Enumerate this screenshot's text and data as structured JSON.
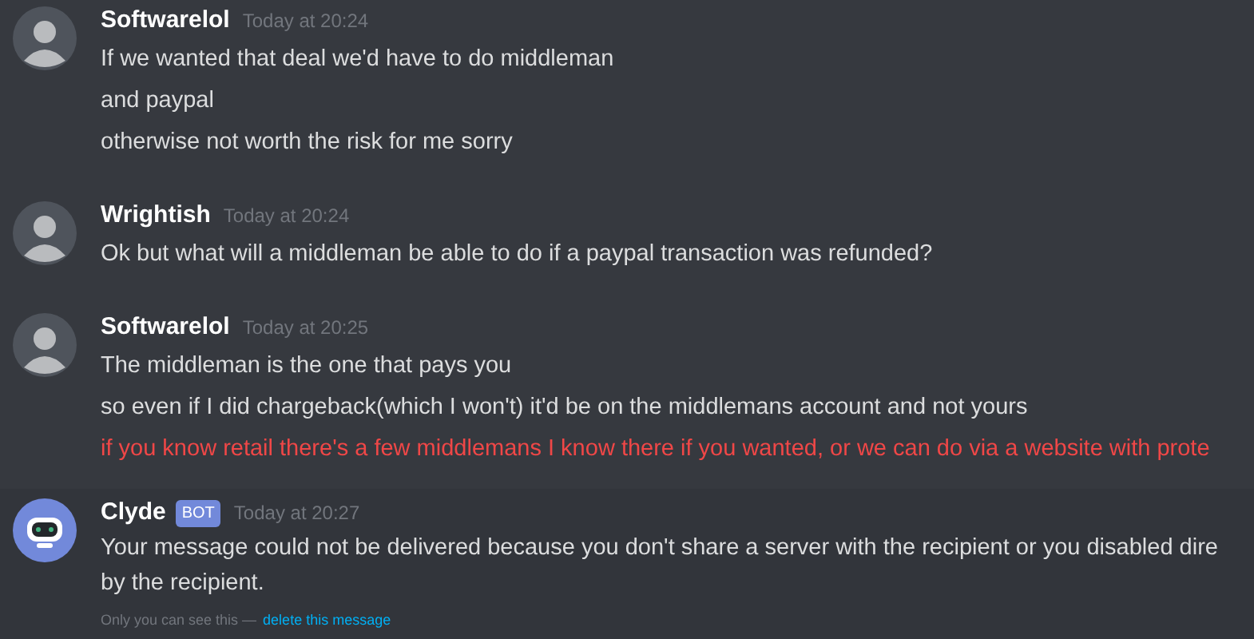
{
  "messages": [
    {
      "author": "Softwarelol",
      "time": "Today at 20:24",
      "ephemeral": false,
      "lines": [
        {
          "kind": "normal",
          "text": "If we wanted that deal we'd have to do middleman"
        },
        {
          "kind": "normal",
          "text": "and paypal"
        },
        {
          "kind": "normal",
          "text": "otherwise not worth the risk for me sorry"
        }
      ]
    },
    {
      "author": "Wrightish",
      "time": "Today at 20:24",
      "ephemeral": false,
      "lines": [
        {
          "kind": "normal",
          "text": "Ok but what will a middleman be able to do if a paypal transaction was refunded?"
        }
      ]
    },
    {
      "author": "Softwarelol",
      "time": "Today at 20:25",
      "ephemeral": false,
      "lines": [
        {
          "kind": "normal",
          "text": "The middleman is the one that pays you"
        },
        {
          "kind": "normal",
          "text": "so even if I did chargeback(which I won't) it'd be on the middlemans account and not yours"
        },
        {
          "kind": "failed",
          "text": "if you know retail there's a few middlemans I know there if you wanted, or we can do via a website with prote"
        }
      ]
    },
    {
      "author": "Clyde",
      "badge": "BOT",
      "time": "Today at 20:27",
      "ephemeral": true,
      "lines": [
        {
          "kind": "wrapped",
          "text": "Your message could not be delivered because you don't share a server with the recipient or you disabled dire"
        },
        {
          "kind": "wrapped",
          "text": "by the recipient."
        }
      ],
      "note": "Only you can see this —",
      "note_link": "delete this message"
    }
  ]
}
